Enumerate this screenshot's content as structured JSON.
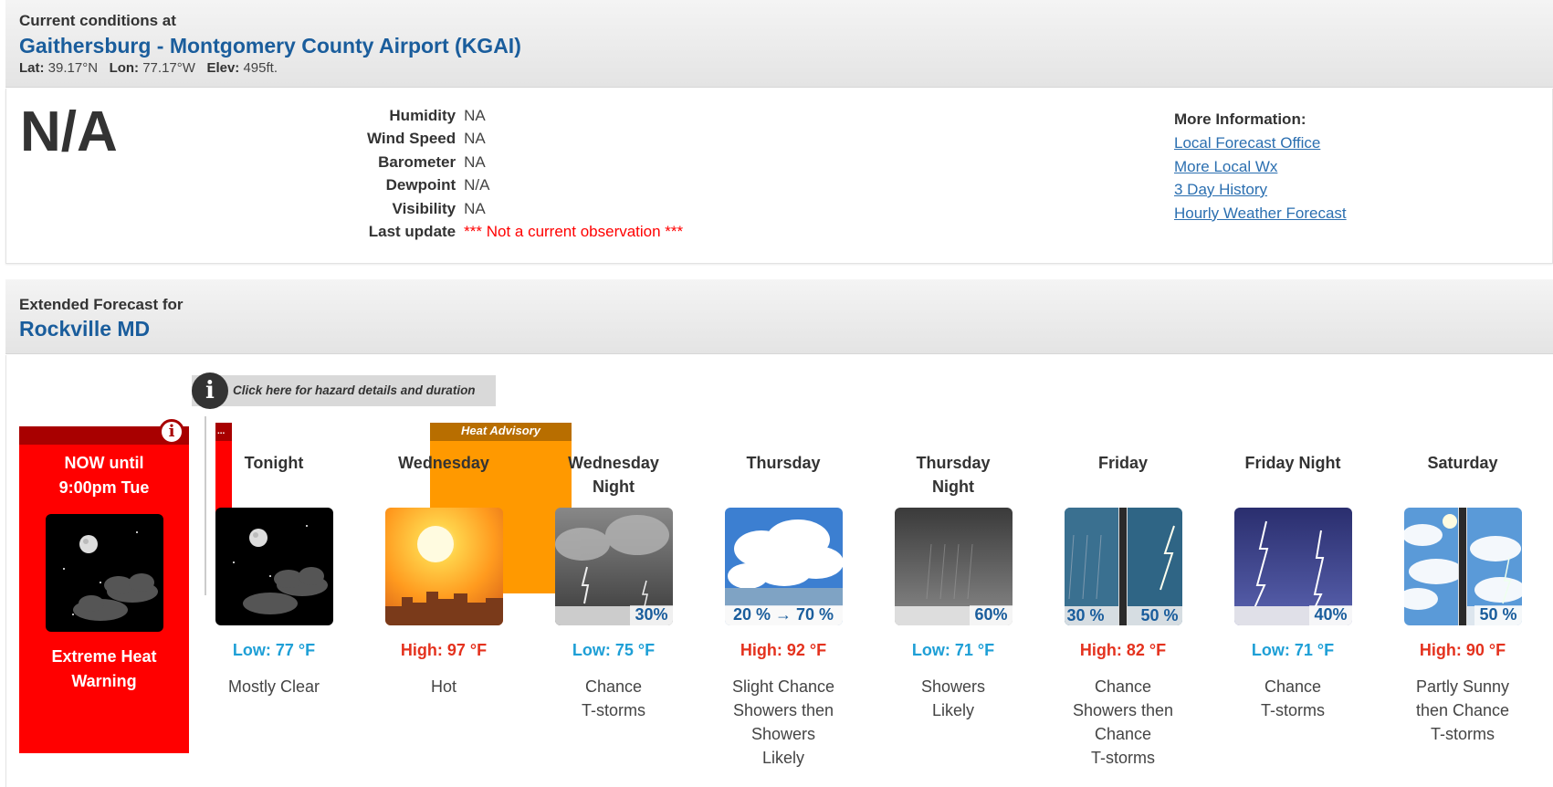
{
  "current": {
    "label": "Current conditions at",
    "station": "Gaithersburg - Montgomery County Airport (KGAI)",
    "lat_label": "Lat:",
    "lat": "39.17°N",
    "lon_label": "Lon:",
    "lon": "77.17°W",
    "elev_label": "Elev:",
    "elev": "495ft.",
    "temperature": "N/A",
    "rows": [
      {
        "label": "Humidity",
        "value": "NA"
      },
      {
        "label": "Wind Speed",
        "value": "NA"
      },
      {
        "label": "Barometer",
        "value": "NA"
      },
      {
        "label": "Dewpoint",
        "value": "N/A"
      },
      {
        "label": "Visibility",
        "value": "NA"
      },
      {
        "label": "Last update",
        "value": "*** Not a current observation ***"
      }
    ],
    "more_info_title": "More Information:",
    "links": [
      "Local Forecast Office",
      "More Local Wx",
      "3 Day History",
      "Hourly Weather Forecast"
    ]
  },
  "extended": {
    "label": "Extended Forecast for",
    "place": "Rockville MD",
    "hazard_bar_text": "Click here for hazard details and duration",
    "warning": {
      "when_line1": "NOW until",
      "when_line2": "9:00pm Tue",
      "name_line1": "Extreme Heat",
      "name_line2": "Warning"
    },
    "strip_dots": "...",
    "advisory_label": "Heat Advisory",
    "periods": [
      {
        "name1": "Tonight",
        "name2": "",
        "temp": "Low: 77 °F",
        "kind": "low",
        "desc1": "Mostly Clear",
        "desc2": "",
        "desc3": "",
        "desc4": "",
        "icon": "night-clear-icon",
        "pop": ""
      },
      {
        "name1": "Wednesday",
        "name2": "",
        "temp": "High: 97 °F",
        "kind": "high",
        "desc1": "Hot",
        "desc2": "",
        "desc3": "",
        "desc4": "",
        "icon": "hot-sun-icon",
        "pop": ""
      },
      {
        "name1": "Wednesday",
        "name2": "Night",
        "temp": "Low: 75 °F",
        "kind": "low",
        "desc1": "Chance",
        "desc2": "T-storms",
        "desc3": "",
        "desc4": "",
        "icon": "night-tstorm-icon",
        "pop": "30%"
      },
      {
        "name1": "Thursday",
        "name2": "",
        "temp": "High: 92 °F",
        "kind": "high",
        "desc1": "Slight Chance",
        "desc2": "Showers then",
        "desc3": "Showers",
        "desc4": "Likely",
        "icon": "day-showers-icon",
        "pop": "20 % → 70 %"
      },
      {
        "name1": "Thursday",
        "name2": "Night",
        "temp": "Low: 71 °F",
        "kind": "low",
        "desc1": "Showers",
        "desc2": "Likely",
        "desc3": "",
        "desc4": "",
        "icon": "night-showers-icon",
        "pop": "60%"
      },
      {
        "name1": "Friday",
        "name2": "",
        "temp": "High: 82 °F",
        "kind": "high",
        "desc1": "Chance",
        "desc2": "Showers then",
        "desc3": "Chance",
        "desc4": "T-storms",
        "icon": "showers-tstorm-split-icon",
        "pop_left": "30 %",
        "pop_right": "50 %",
        "pop": ""
      },
      {
        "name1": "Friday Night",
        "name2": "",
        "temp": "Low: 71 °F",
        "kind": "low",
        "desc1": "Chance",
        "desc2": "T-storms",
        "desc3": "",
        "desc4": "",
        "icon": "lightning-night-icon",
        "pop": "40%"
      },
      {
        "name1": "Saturday",
        "name2": "",
        "temp": "High: 90 °F",
        "kind": "high",
        "desc1": "Partly Sunny",
        "desc2": "then Chance",
        "desc3": "T-storms",
        "desc4": "",
        "icon": "partly-sunny-tstorm-split-icon",
        "pop": "50 %"
      }
    ]
  }
}
